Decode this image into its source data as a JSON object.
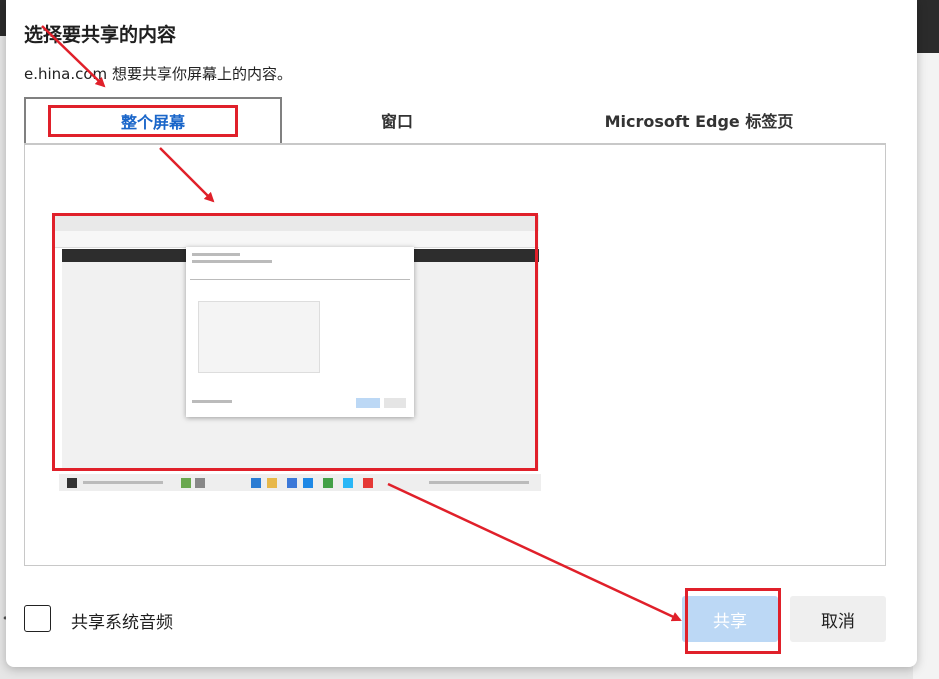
{
  "dialog": {
    "title": "选择要共享的内容",
    "subtitle": "e.hina.com 想要共享你屏幕上的内容。"
  },
  "tabs": [
    {
      "label": "整个屏幕",
      "selected": true
    },
    {
      "label": "窗口",
      "selected": false
    },
    {
      "label": "Microsoft Edge 标签页",
      "selected": false
    }
  ],
  "options": {
    "share_audio_label": "共享系统音频",
    "share_audio_checked": false
  },
  "buttons": {
    "share_label": "共享",
    "cancel_label": "取消",
    "share_enabled": false
  },
  "colors": {
    "accent": "#1a66c9",
    "share_disabled_bg": "#bcd8f5",
    "annotation_red": "#e0202a"
  }
}
